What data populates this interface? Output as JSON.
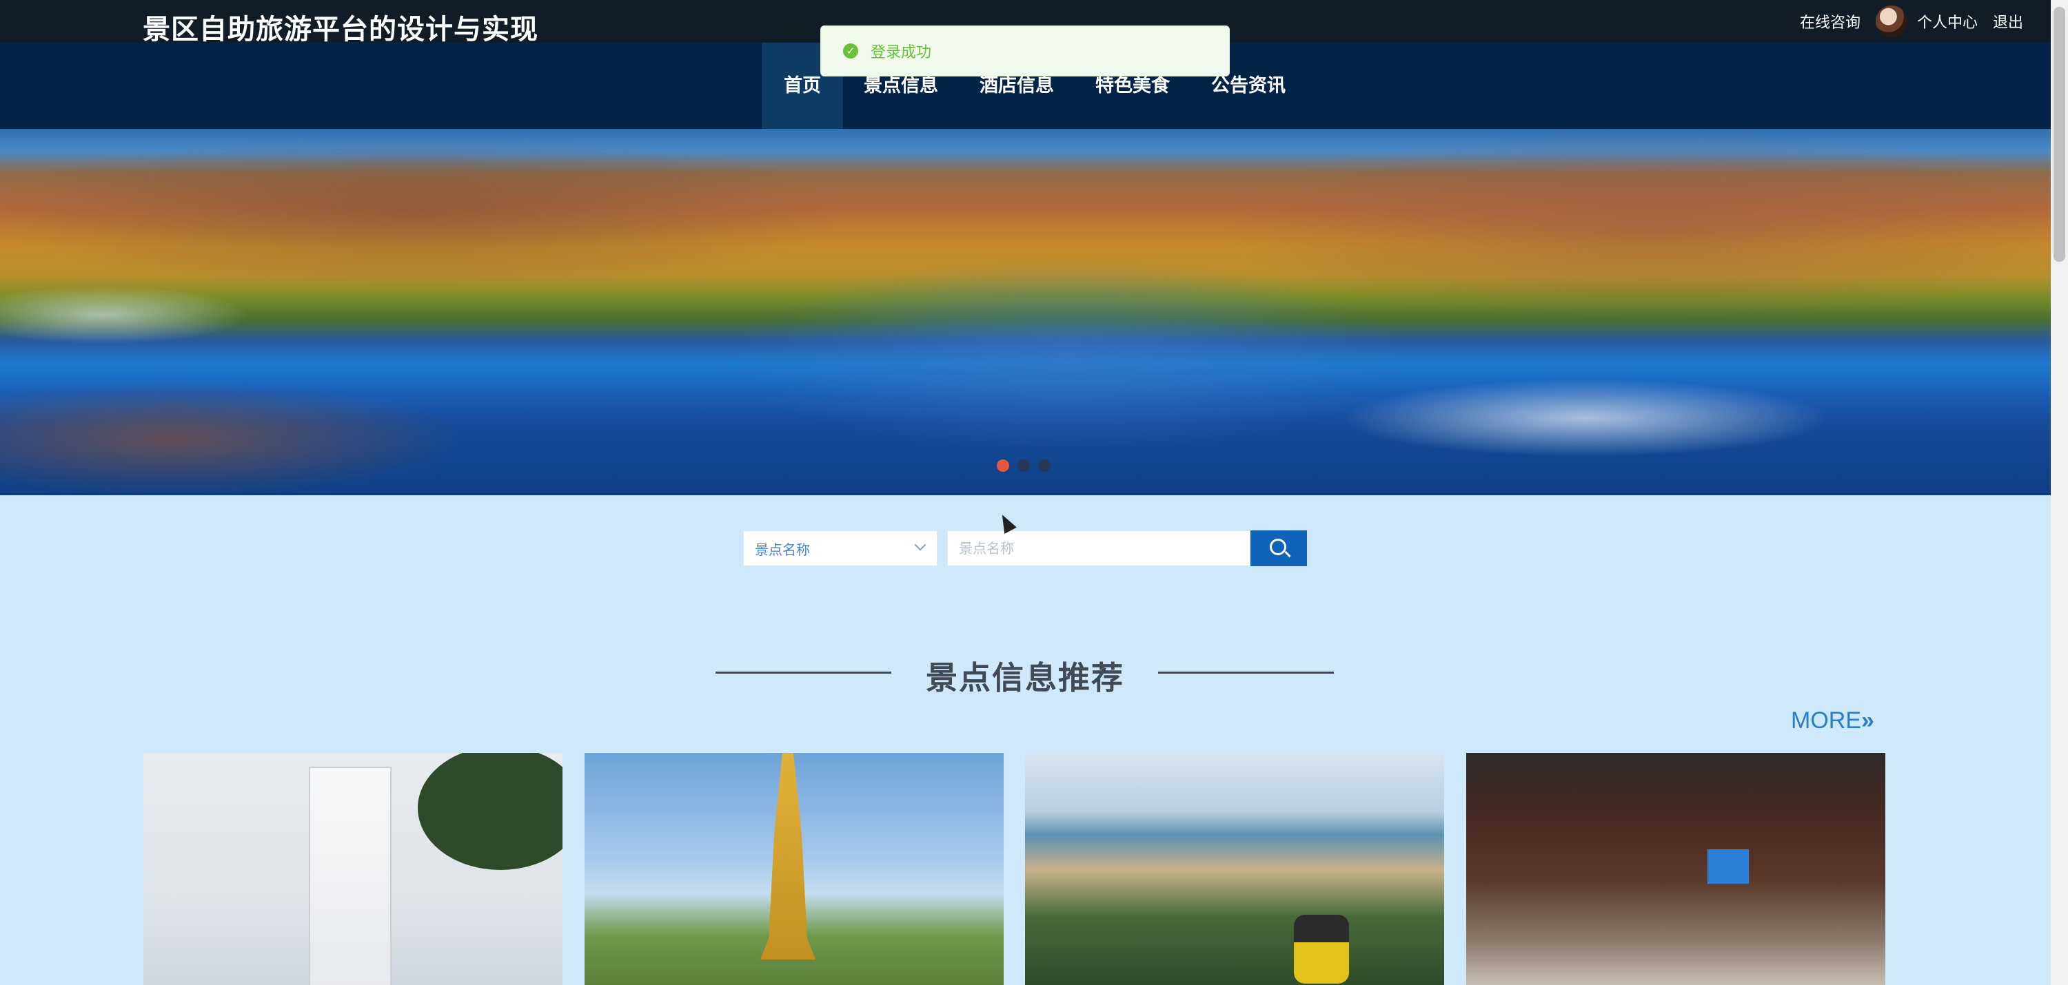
{
  "header": {
    "site_title": "景区自助旅游平台的设计与实现",
    "links": {
      "consult": "在线咨询",
      "profile": "个人中心",
      "logout": "退出"
    }
  },
  "nav": {
    "items": [
      {
        "label": "首页",
        "active": true
      },
      {
        "label": "景点信息"
      },
      {
        "label": "酒店信息"
      },
      {
        "label": "特色美食"
      },
      {
        "label": "公告资讯"
      }
    ]
  },
  "toast": {
    "message": "登录成功",
    "type": "success"
  },
  "banner": {
    "slide_count": 3,
    "active_index": 0
  },
  "search": {
    "select_value": "景点名称",
    "input_placeholder": "景点名称"
  },
  "section": {
    "title": "景点信息推荐",
    "more_label": "MORE"
  },
  "cards": [
    {
      "image": "church-tower"
    },
    {
      "image": "golden-statue"
    },
    {
      "image": "cable-car-view"
    },
    {
      "image": "scenic-gate"
    }
  ],
  "colors": {
    "topbar": "#121c26",
    "navbar": "#032447",
    "accent": "#1063b8",
    "page_bg": "#cde9fb",
    "success": "#67c23a"
  }
}
